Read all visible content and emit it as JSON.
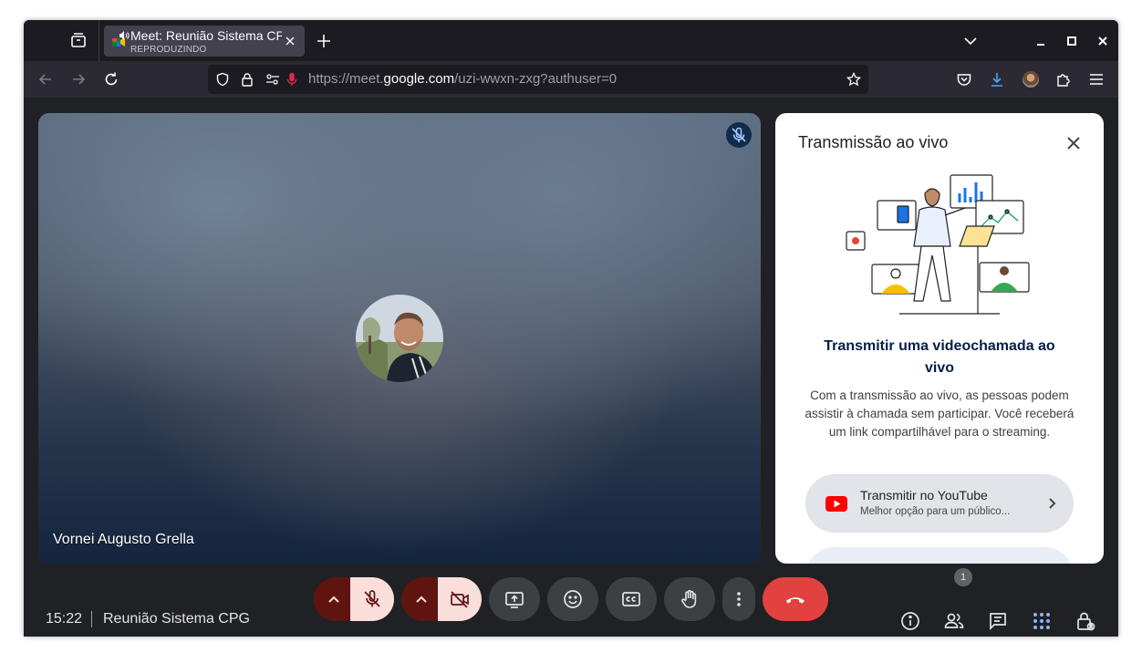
{
  "browser": {
    "tab_title": "Meet: Reunião Sistema CPG",
    "tab_subtitle": "REPRODUZINDO",
    "url_prefix": "https://meet.",
    "url_domain": "google.com",
    "url_path": "/uzi-wwxn-zxg?authuser=0"
  },
  "video": {
    "participant_name": "Vornei Augusto Grella"
  },
  "panel": {
    "title": "Transmissão ao vivo",
    "heading": "Transmitir uma videochamada ao vivo",
    "description": "Com a transmissão ao vivo, as pessoas podem assistir à chamada sem participar. Você receberá um link compartilhável para o streaming.",
    "youtube_title": "Transmitir no YouTube",
    "youtube_subtitle": "Melhor opção para um público..."
  },
  "bottom_bar": {
    "time": "15:22",
    "meeting_name": "Reunião Sistema CPG",
    "people_count": "1"
  },
  "colors": {
    "accent_red": "#e2423f",
    "muted_bg": "#f9dedc",
    "muted_dark": "#601410",
    "control_bg": "#3c4043",
    "apps_blue": "#8ab4f8",
    "panel_heading": "#041e49"
  },
  "icons": [
    "overview-icon",
    "meet-favicon",
    "speaker-icon",
    "close-icon",
    "plus-icon",
    "chevron-down-icon",
    "minimize-icon",
    "maximize-icon",
    "back-icon",
    "forward-icon",
    "reload-icon",
    "shield-icon",
    "lock-icon",
    "permissions-icon",
    "mic-blocked-icon",
    "star-icon",
    "pocket-icon",
    "download-icon",
    "account-avatar",
    "extensions-icon",
    "menu-icon",
    "mic-off-icon",
    "camera-off-icon",
    "present-icon",
    "emoji-icon",
    "captions-icon",
    "hand-icon",
    "more-icon",
    "hangup-icon",
    "info-icon",
    "people-icon",
    "chat-icon",
    "apps-icon",
    "host-controls-icon",
    "youtube-icon",
    "chevron-right-icon"
  ]
}
